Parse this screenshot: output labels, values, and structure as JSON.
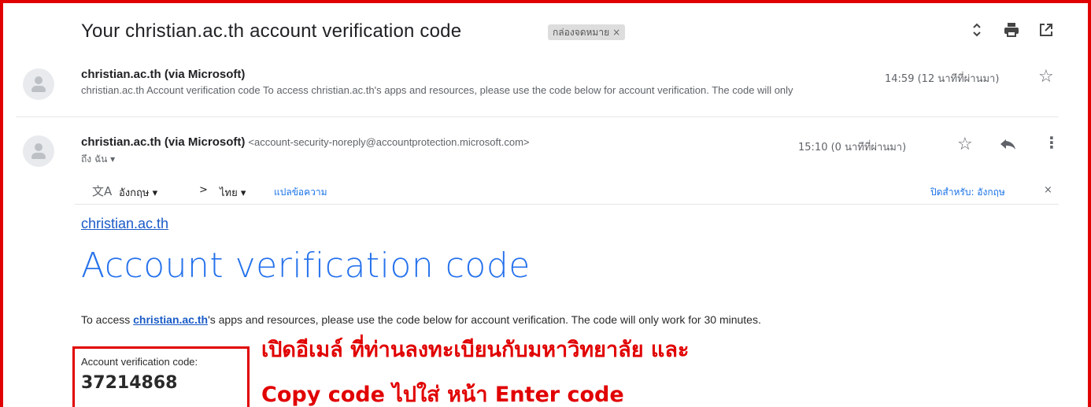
{
  "thread": {
    "subject": "Your christian.ac.th account verification code",
    "label": "กล่องจดหมาย",
    "label_close": "×",
    "icons": [
      "expand-collapse-icon",
      "print-icon",
      "open-in-new-window-icon"
    ]
  },
  "messages": [
    {
      "sender": "christian.ac.th (via Microsoft)",
      "snippet": "christian.ac.th Account verification code To access christian.ac.th's apps and resources, please use the code below for account verification. The code will only",
      "time": "14:59 (12 นาทีที่ผ่านมา)",
      "star": "☆"
    },
    {
      "sender": "christian.ac.th (via Microsoft)",
      "email": "<account-security-noreply@accountprotection.microsoft.com>",
      "time": "15:10 (0 นาทีที่ผ่านมา)",
      "to": "ถึง ฉัน ▾",
      "star": "☆",
      "reply": "⤺",
      "more": "⋮"
    }
  ],
  "translate": {
    "icon": "文A",
    "from": "อังกฤษ ▾",
    "arrow": ">",
    "to": "ไทย ▾",
    "action": "แปลข้อความ",
    "turn_off": "ปิดสำหรับ: อังกฤษ",
    "turn_off_close": "×"
  },
  "email_body": {
    "org_link": "christian.ac.th",
    "title": "Account verification code",
    "text_before": "To access ",
    "text_link": "christian.ac.th",
    "text_after": "'s apps and resources, please use the code below for account verification. The code will only work for 30 minutes.",
    "code_label": "Account verification code:",
    "code": "37214868"
  },
  "annotations": {
    "line1": "เปิดอีเมล์ ที่ท่านลงทะเบียนกับมหาวิทยาลัย และ",
    "line2": "Copy code ไปใส่ หน้า Enter code",
    "color": "#e10000"
  }
}
